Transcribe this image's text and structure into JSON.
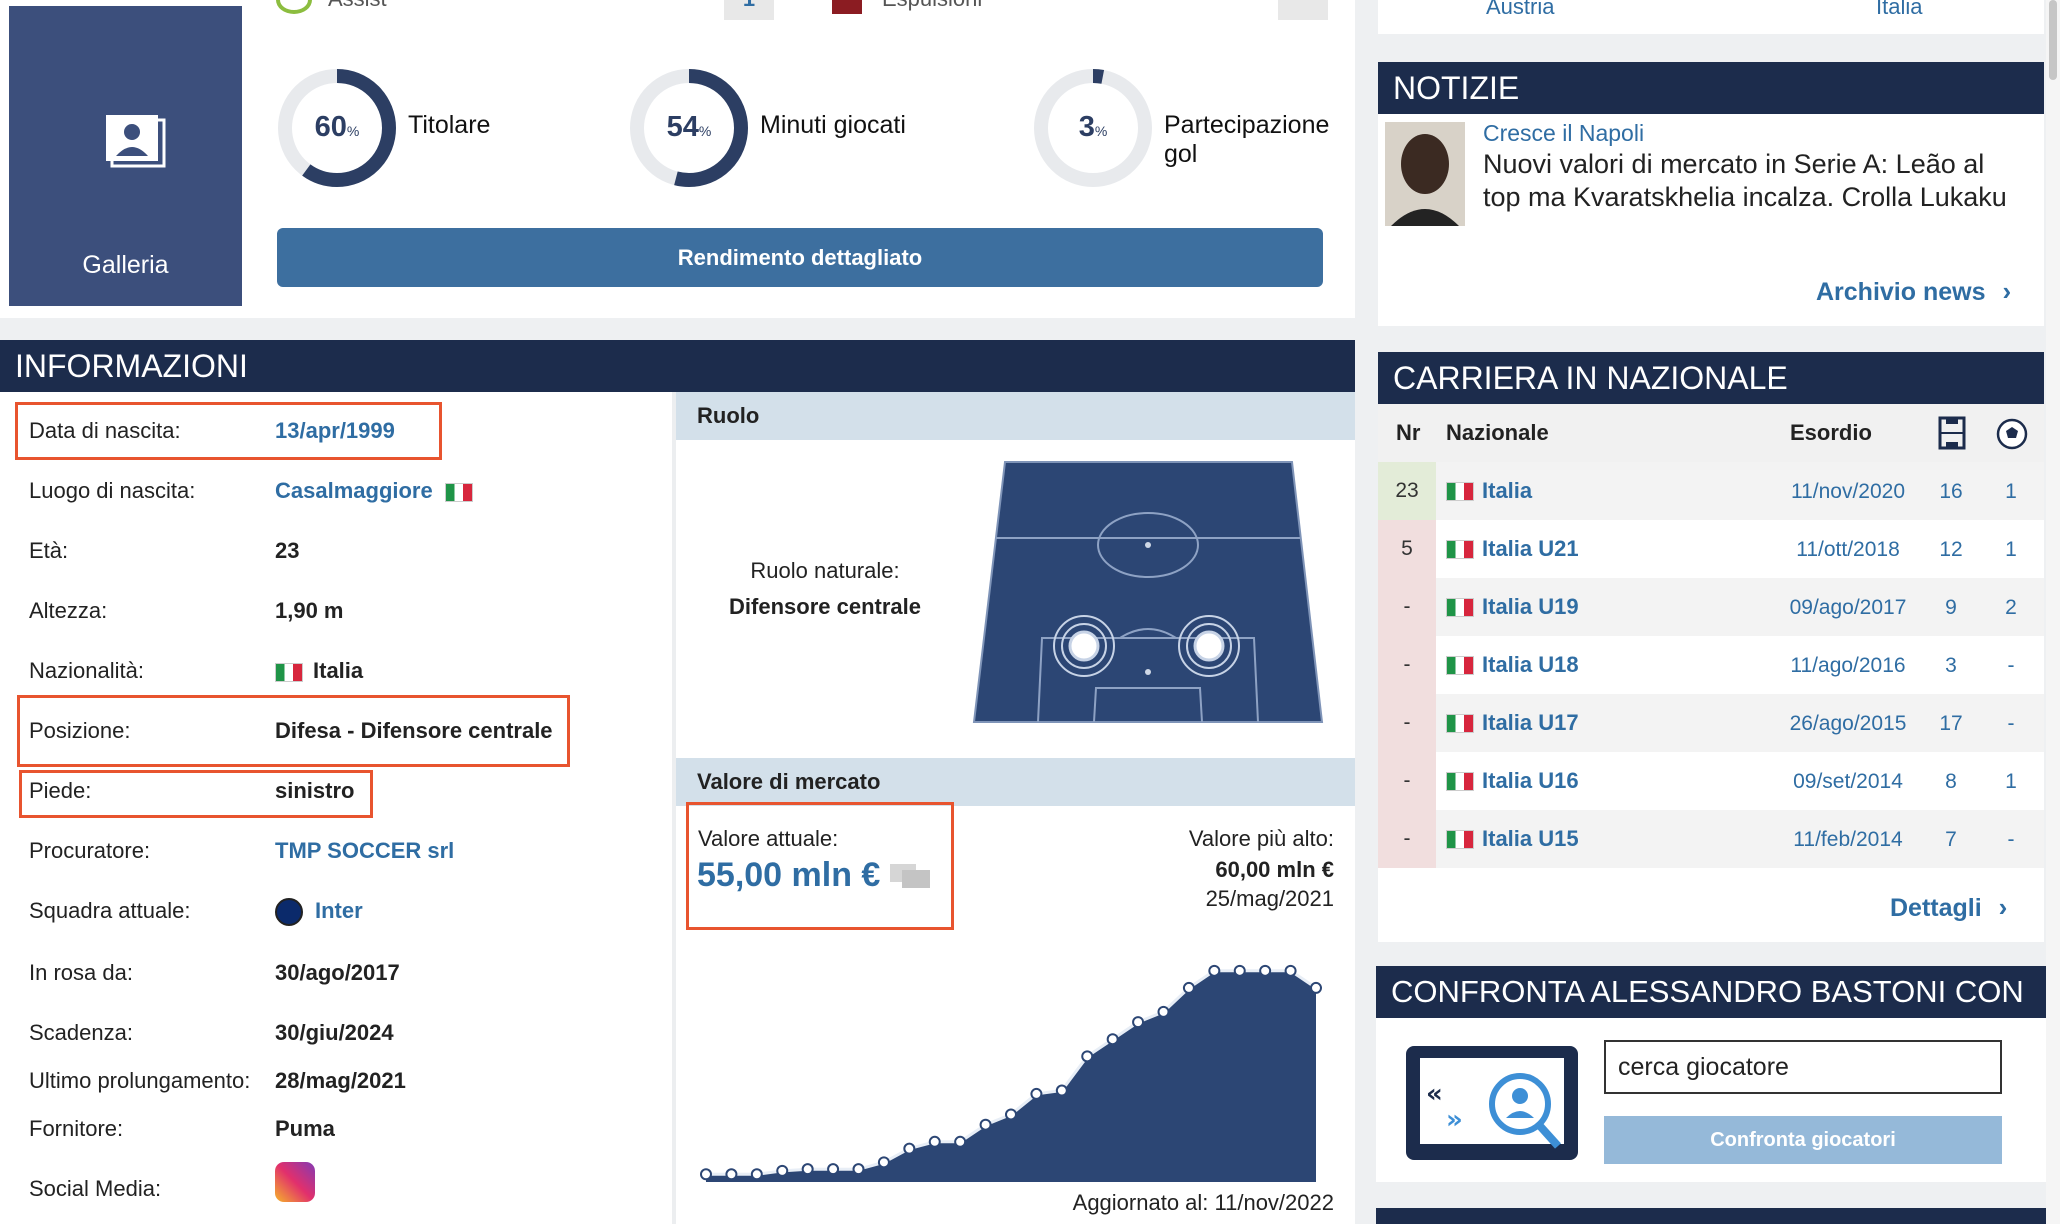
{
  "top_stats": {
    "assist_label": "Assist",
    "assist_value": "1",
    "expulsions_label": "Espulsioni"
  },
  "gallery": {
    "label": "Galleria",
    "icon": "gallery-icon"
  },
  "donuts": [
    {
      "value": "60",
      "unit": "%",
      "label": "Titolare",
      "fraction": 0.6
    },
    {
      "value": "54",
      "unit": "%",
      "label": "Minuti giocati",
      "fraction": 0.54
    },
    {
      "value": "3",
      "unit": "%",
      "label": "Partecipazione gol",
      "fraction": 0.03
    }
  ],
  "detail_button": "Rendimento dettagliato",
  "info": {
    "title": "INFORMAZIONI",
    "rows": [
      {
        "label": "Data di nascita:",
        "value": "13/apr/1999"
      },
      {
        "label": "Luogo di nascita:",
        "value": "Casalmaggiore"
      },
      {
        "label": "Età:",
        "value": "23"
      },
      {
        "label": "Altezza:",
        "value": "1,90 m"
      },
      {
        "label": "Nazionalità:",
        "value": "Italia"
      },
      {
        "label": "Posizione:",
        "value": "Difesa - Difensore centrale"
      },
      {
        "label": "Piede:",
        "value": "sinistro"
      },
      {
        "label": "Procuratore:",
        "value": "TMP SOCCER srl"
      },
      {
        "label": "Squadra attuale:",
        "value": "Inter"
      },
      {
        "label": "In rosa da:",
        "value": "30/ago/2017"
      },
      {
        "label": "Scadenza:",
        "value": "30/giu/2024"
      },
      {
        "label": "Ultimo prolungamento:",
        "value": "28/mag/2021"
      },
      {
        "label": "Fornitore:",
        "value": "Puma"
      },
      {
        "label": "Social Media:",
        "value": ""
      }
    ]
  },
  "role": {
    "header": "Ruolo",
    "natural_label": "Ruolo naturale:",
    "natural_value": "Difensore centrale"
  },
  "market": {
    "header": "Valore di mercato",
    "current_label": "Valore attuale:",
    "current_value": "55,00 mln €",
    "highest_label": "Valore più alto:",
    "highest_value": "60,00 mln €",
    "highest_date": "25/mag/2021",
    "updated": "Aggiornato al: 11/nov/2022"
  },
  "chart_data": {
    "type": "area",
    "series": [
      {
        "values": [
          0.5,
          0.5,
          0.5,
          1.5,
          2,
          2,
          2,
          4,
          8,
          10,
          10,
          15,
          18,
          24,
          25,
          35,
          40,
          45,
          48,
          55,
          60,
          60,
          60,
          60,
          55
        ]
      }
    ],
    "ylim": [
      0,
      62
    ],
    "title": "",
    "xlabel": "",
    "ylabel": "",
    "colors": {
      "fill": "#2c4674",
      "line": "#e8eef6",
      "point": "#ffffff"
    }
  },
  "top_right": {
    "left": "Austria",
    "right": "Italia"
  },
  "news": {
    "title": "NOTIZIE",
    "category": "Cresce il Napoli",
    "headline": "Nuovi valori di mercato in Serie A: Leão al top ma Kvaratskhelia incalza. Crolla Lukaku",
    "archive_link": "Archivio news"
  },
  "national": {
    "title": "CARRIERA IN NAZIONALE",
    "headers": {
      "nr": "Nr",
      "team": "Nazionale",
      "debut": "Esordio"
    },
    "rows": [
      {
        "nr": "23",
        "team": "Italia",
        "debut": "11/nov/2020",
        "apps": "16",
        "goals": "1"
      },
      {
        "nr": "5",
        "team": "Italia U21",
        "debut": "11/ott/2018",
        "apps": "12",
        "goals": "1"
      },
      {
        "nr": "-",
        "team": "Italia U19",
        "debut": "09/ago/2017",
        "apps": "9",
        "goals": "2"
      },
      {
        "nr": "-",
        "team": "Italia U18",
        "debut": "11/ago/2016",
        "apps": "3",
        "goals": "-"
      },
      {
        "nr": "-",
        "team": "Italia U17",
        "debut": "26/ago/2015",
        "apps": "17",
        "goals": "-"
      },
      {
        "nr": "-",
        "team": "Italia U16",
        "debut": "09/set/2014",
        "apps": "8",
        "goals": "1"
      },
      {
        "nr": "-",
        "team": "Italia U15",
        "debut": "11/feb/2014",
        "apps": "7",
        "goals": "-"
      }
    ],
    "details_link": "Dettagli"
  },
  "compare": {
    "title": "CONFRONTA ALESSANDRO BASTONI CON",
    "placeholder": "cerca giocatore",
    "button": "Confronta giocatori"
  },
  "colors": {
    "navy": "#1c2c4c",
    "link": "#2f6da3",
    "highlight": "#e8542f",
    "button": "#3d6f9f"
  }
}
